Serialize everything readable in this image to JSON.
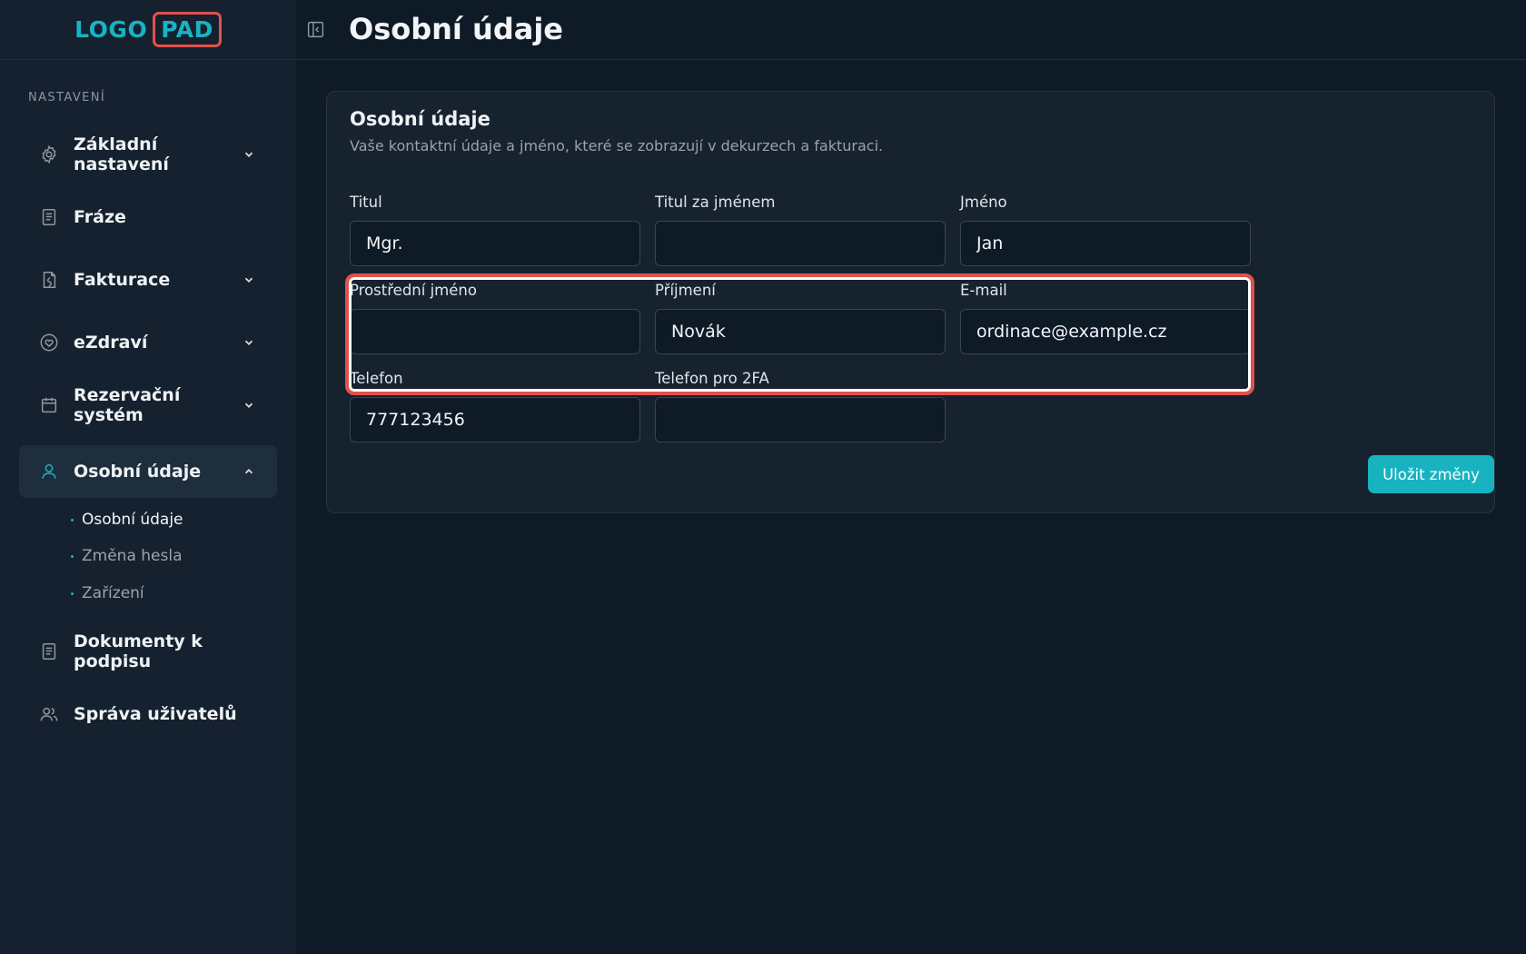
{
  "logo": {
    "part1": "LOGO",
    "part2": "PAD"
  },
  "sidebar": {
    "section_label": "NASTAVENÍ",
    "items": [
      {
        "label": "Základní nastavení",
        "icon": "gear-icon",
        "has_chevron": true
      },
      {
        "label": "Fráze",
        "icon": "document-icon",
        "has_chevron": false
      },
      {
        "label": "Fakturace",
        "icon": "invoice-icon",
        "has_chevron": true
      },
      {
        "label": "eZdraví",
        "icon": "heart-icon",
        "has_chevron": true
      },
      {
        "label": "Rezervační systém",
        "icon": "calendar-icon",
        "has_chevron": true
      },
      {
        "label": "Osobní údaje",
        "icon": "user-icon",
        "has_chevron": true,
        "expanded": true,
        "active": true
      },
      {
        "label": "Dokumenty k podpisu",
        "icon": "document-icon",
        "has_chevron": false
      },
      {
        "label": "Správa uživatelů",
        "icon": "users-icon",
        "has_chevron": false
      }
    ],
    "subitems": [
      {
        "label": "Osobní údaje",
        "current": true
      },
      {
        "label": "Změna hesla"
      },
      {
        "label": "Zařízení"
      }
    ]
  },
  "header": {
    "title": "Osobní údaje"
  },
  "card": {
    "title": "Osobní údaje",
    "description": "Vaše kontaktní údaje a jméno, které se zobrazují v dekurzech a fakturaci.",
    "fields": {
      "titul": {
        "label": "Titul",
        "value": "Mgr."
      },
      "titul_za": {
        "label": "Titul za jménem",
        "value": ""
      },
      "jmeno": {
        "label": "Jméno",
        "value": "Jan"
      },
      "prostredni": {
        "label": "Prostřední jméno",
        "value": ""
      },
      "prijmeni": {
        "label": "Příjmení",
        "value": "Novák"
      },
      "email": {
        "label": "E-mail",
        "value": "ordinace@example.cz"
      },
      "telefon": {
        "label": "Telefon",
        "value": "777123456"
      },
      "telefon_2fa": {
        "label": "Telefon pro 2FA",
        "value": ""
      }
    },
    "save_label": "Uložit změny"
  },
  "colors": {
    "accent": "#17b3c1",
    "highlight": "#e2524b",
    "background": "#0f1a27",
    "sidebar": "#16212f"
  }
}
